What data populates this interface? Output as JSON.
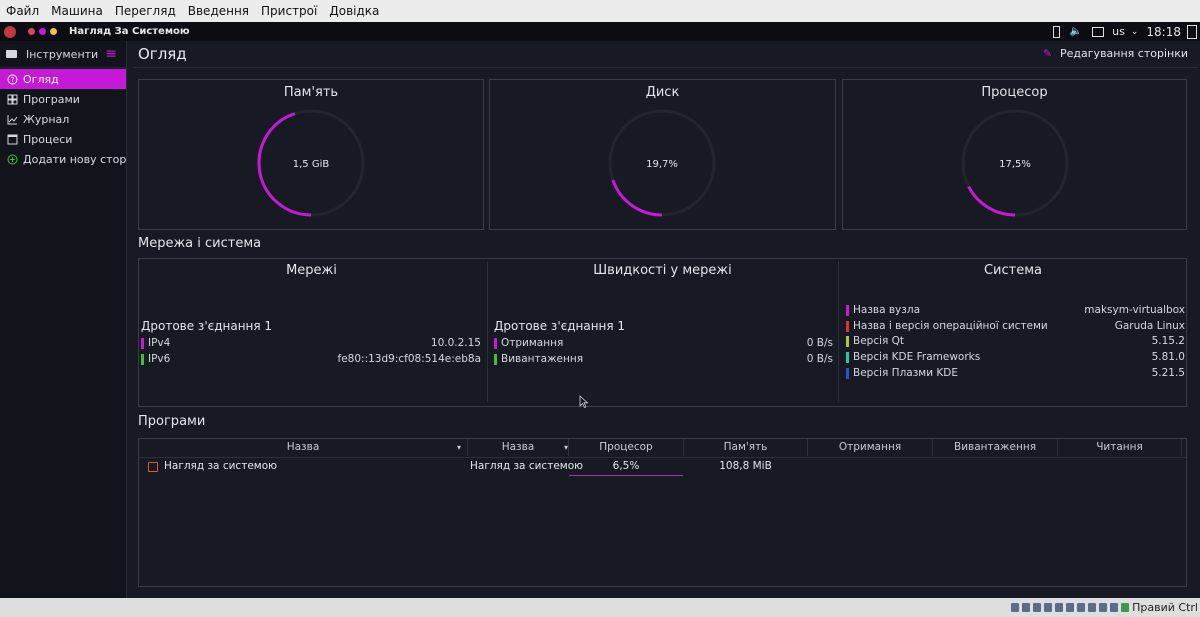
{
  "vbox_menu": [
    "Файл",
    "Машина",
    "Перегляд",
    "Введення",
    "Пристрої",
    "Довідка"
  ],
  "topbar": {
    "title": "Нагляд За Системою",
    "layout": "us",
    "time": "18:18"
  },
  "sidebar": {
    "header": "Інструменти",
    "items": [
      {
        "label": "Огляд",
        "icon": "help-circle-icon"
      },
      {
        "label": "Програми",
        "icon": "grid-icon"
      },
      {
        "label": "Журнал",
        "icon": "chart-icon"
      },
      {
        "label": "Процеси",
        "icon": "window-icon"
      },
      {
        "label": "Додати нову сторі...",
        "icon": "plus-circle-icon"
      }
    ]
  },
  "page": {
    "title": "Огляд",
    "edit_label": "Редагування сторінки"
  },
  "gauges": [
    {
      "title": "Пам'ять",
      "value_label": "1,5 GiB",
      "fraction": 0.45
    },
    {
      "title": "Диск",
      "value_label": "19,7%",
      "fraction": 0.197
    },
    {
      "title": "Процесор",
      "value_label": "17,5%",
      "fraction": 0.175
    }
  ],
  "network_section": {
    "title": "Мережа і система",
    "networks": {
      "title": "Мережі",
      "connection": "Дротове з'єднання 1",
      "rows": [
        {
          "label": "IPv4",
          "value": "10.0.2.15",
          "color": "#c519d7"
        },
        {
          "label": "IPv6",
          "value": "fe80::13d9:cf08:514e:eb8a",
          "color": "#3dc23a"
        }
      ]
    },
    "speeds": {
      "title": "Швидкості у мережі",
      "connection": "Дротове з'єднання 1",
      "rows": [
        {
          "label": "Отримання",
          "value": "0 B/s",
          "color": "#c519d7"
        },
        {
          "label": "Вивантаження",
          "value": "0 B/s",
          "color": "#3dc23a"
        }
      ]
    },
    "system": {
      "title": "Система",
      "rows": [
        {
          "label": "Назва вузла",
          "value": "maksym-virtualbox",
          "color": "#c519d7"
        },
        {
          "label": "Назва і версія операційної системи",
          "value": "Garuda Linux",
          "color": "#d83636"
        },
        {
          "label": "Версія Qt",
          "value": "5.15.2",
          "color": "#a7c93a"
        },
        {
          "label": "Версія KDE Frameworks",
          "value": "5.81.0",
          "color": "#27c7a0"
        },
        {
          "label": "Версія Плазми KDE",
          "value": "5.21.5",
          "color": "#2a52d4"
        }
      ]
    }
  },
  "apps_section": {
    "title": "Програми",
    "columns": [
      "Назва",
      "Назва",
      "Процесор",
      "Пам'ять",
      "Отримання",
      "Вивантаження",
      "Читання"
    ],
    "rows": [
      {
        "name": "Нагляд за системою",
        "name2": "Нагляд за системою",
        "cpu": "6,5%",
        "cpu_fraction": 0.065,
        "memory": "108,8 MiB"
      }
    ]
  },
  "taskbar": {
    "right_label": "Правий Ctrl"
  },
  "colors": {
    "accent": "#c519d7",
    "bg": "#171a23"
  }
}
